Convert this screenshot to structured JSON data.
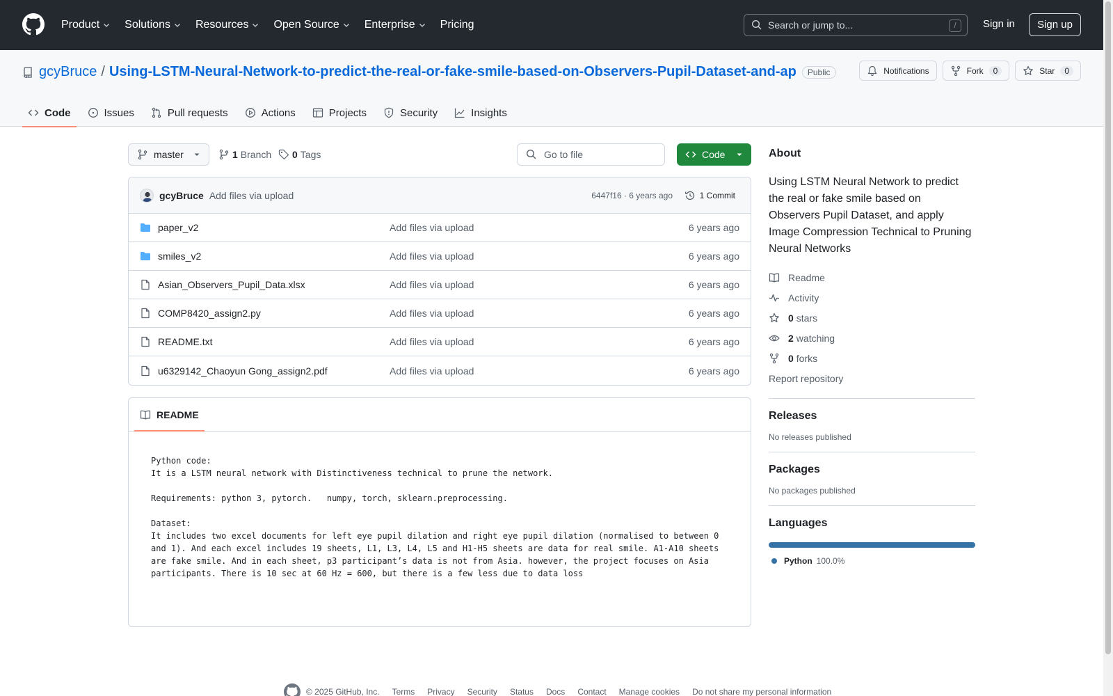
{
  "header": {
    "nav": [
      {
        "label": "Product",
        "dropdown": true
      },
      {
        "label": "Solutions",
        "dropdown": true
      },
      {
        "label": "Resources",
        "dropdown": true
      },
      {
        "label": "Open Source",
        "dropdown": true
      },
      {
        "label": "Enterprise",
        "dropdown": true
      },
      {
        "label": "Pricing",
        "dropdown": false
      }
    ],
    "search_placeholder": "Search or jump to...",
    "search_shortcut": "/",
    "sign_in": "Sign in",
    "sign_up": "Sign up"
  },
  "repo": {
    "owner": "gcyBruce",
    "separator": "/",
    "name": "Using-LSTM-Neural-Network-to-predict-the-real-or-fake-smile-based-on-Observers-Pupil-Dataset-and-ap",
    "visibility": "Public",
    "notifications_label": "Notifications",
    "fork_label": "Fork",
    "fork_count": "0",
    "star_label": "Star",
    "star_count": "0"
  },
  "tabs": [
    {
      "label": "Code",
      "icon": "code-icon",
      "active": true
    },
    {
      "label": "Issues",
      "icon": "issue-icon",
      "active": false
    },
    {
      "label": "Pull requests",
      "icon": "pull-request-icon",
      "active": false
    },
    {
      "label": "Actions",
      "icon": "play-icon",
      "active": false
    },
    {
      "label": "Projects",
      "icon": "table-icon",
      "active": false
    },
    {
      "label": "Security",
      "icon": "shield-icon",
      "active": false
    },
    {
      "label": "Insights",
      "icon": "graph-icon",
      "active": false
    }
  ],
  "toolbar": {
    "branch": "master",
    "branch_count": "1",
    "branch_label": "Branch",
    "tag_count": "0",
    "tag_label": "Tags",
    "go_to_file": "Go to file",
    "code_label": "Code"
  },
  "commit": {
    "author": "gcyBruce",
    "message": "Add files via upload",
    "meta": "6447f16 · 6 years ago",
    "count": "1 Commit"
  },
  "files": [
    {
      "name": "paper_v2",
      "type": "folder",
      "message": "Add files via upload",
      "age": "6 years ago"
    },
    {
      "name": "smiles_v2",
      "type": "folder",
      "message": "Add files via upload",
      "age": "6 years ago"
    },
    {
      "name": "Asian_Observers_Pupil_Data.xlsx",
      "type": "file",
      "message": "Add files via upload",
      "age": "6 years ago"
    },
    {
      "name": "COMP8420_assign2.py",
      "type": "file",
      "message": "Add files via upload",
      "age": "6 years ago"
    },
    {
      "name": "README.txt",
      "type": "file",
      "message": "Add files via upload",
      "age": "6 years ago"
    },
    {
      "name": "u6329142_Chaoyun Gong_assign2.pdf",
      "type": "file",
      "message": "Add files via upload",
      "age": "6 years ago"
    }
  ],
  "readme": {
    "tab_label": "README",
    "content": "Python code:\nIt is a LSTM neural network with Distinctiveness technical to prune the network.\n\nRequirements: python 3, pytorch.   numpy, torch, sklearn.preprocessing.\n\nDataset:\nIt includes two excel documents for left eye pupil dilation and right eye pupil dilation (normalised to between 0\nand 1). And each excel includes 19 sheets, L1, L3, L4, L5 and H1-H5 sheets are data for real smile. A1-A10 sheets\nare fake smile. And in each sheet, p3 participant’s data is not from Asia. however, the project focuses on Asia\nparticipants. There is 10 sec at 60 Hz = 600, but there is a few less due to data loss"
  },
  "sidebar": {
    "about_title": "About",
    "description": "Using LSTM Neural Network to predict the real or fake smile based on Observers Pupil Dataset, and apply Image Compression Technical to Pruning Neural Networks",
    "readme_label": "Readme",
    "activity_label": "Activity",
    "stars_count": "0",
    "stars_label": "stars",
    "watching_count": "2",
    "watching_label": "watching",
    "forks_count": "0",
    "forks_label": "forks",
    "report_label": "Report repository",
    "releases_title": "Releases",
    "releases_empty": "No releases published",
    "packages_title": "Packages",
    "packages_empty": "No packages published",
    "languages_title": "Languages",
    "language_name": "Python",
    "language_pct": "100.0%",
    "language_color": "#3572A5"
  },
  "footer": {
    "copyright": "© 2025 GitHub, Inc.",
    "links": [
      "Terms",
      "Privacy",
      "Security",
      "Status",
      "Docs",
      "Contact",
      "Manage cookies",
      "Do not share my personal information"
    ]
  }
}
